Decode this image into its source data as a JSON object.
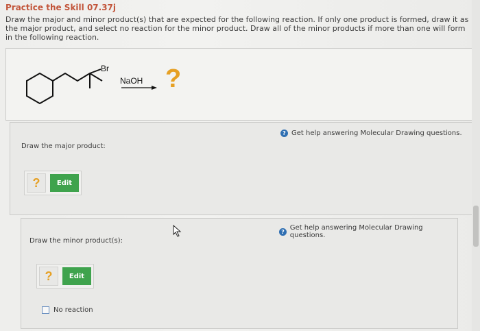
{
  "header": {
    "title": "Practice the Skill 07.37j",
    "instructions": "Draw the major and minor product(s) that are expected for the following reaction. If only one product is formed, draw it as the major product, and select no reaction for the minor product. Draw all of the minor products if more than one will form in the following reaction."
  },
  "reaction": {
    "substituent": "Br",
    "reagent": "NaOH",
    "product_placeholder": "?"
  },
  "major": {
    "help_text": "Get help answering Molecular Drawing questions.",
    "label": "Draw the major product:",
    "qmark": "?",
    "edit_label": "Edit"
  },
  "minor": {
    "help_text": "Get help answering Molecular Drawing questions.",
    "label": "Draw the minor product(s):",
    "qmark": "?",
    "edit_label": "Edit",
    "no_reaction_label": "No reaction"
  },
  "colors": {
    "title": "#c2553a",
    "edit_button": "#3fa34d",
    "question_mark": "#e6a024",
    "help_icon": "#2f6fb2"
  }
}
